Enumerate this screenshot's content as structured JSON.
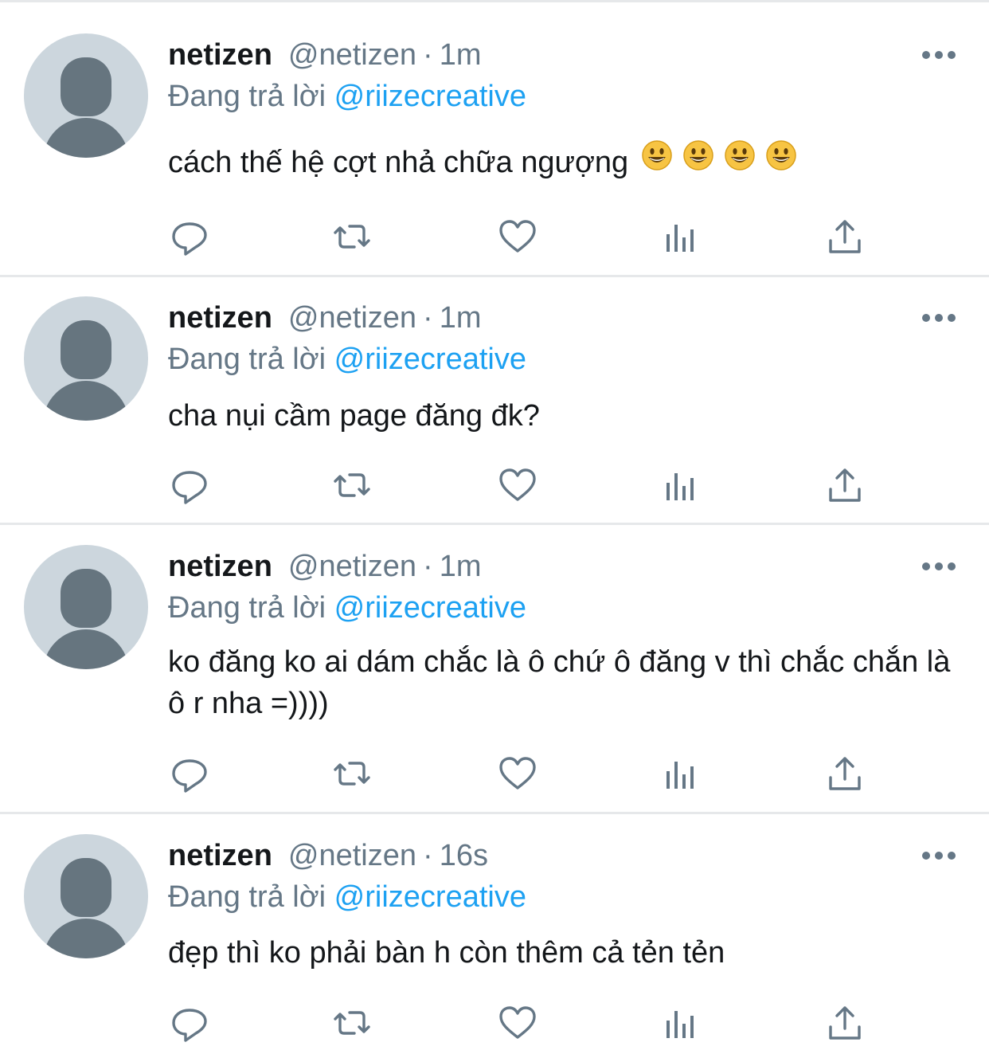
{
  "tweets": [
    {
      "name": "netizen",
      "handle": "@netizen",
      "separator": "·",
      "time": "1m",
      "reply_prefix": "Đang trả lời",
      "reply_to": "@riizecreative",
      "text": "cách thế hệ cợt nhả chữa ngượng",
      "emojis": [
        "grinning-face",
        "grinning-face",
        "grinning-face",
        "grinning-face"
      ]
    },
    {
      "name": "netizen",
      "handle": "@netizen",
      "separator": "·",
      "time": "1m",
      "reply_prefix": "Đang trả lời",
      "reply_to": "@riizecreative",
      "text": "cha nụi cầm page đăng đk?"
    },
    {
      "name": "netizen",
      "handle": "@netizen",
      "separator": "·",
      "time": "1m",
      "reply_prefix": "Đang trả lời",
      "reply_to": "@riizecreative",
      "text": "ko đăng ko ai dám chắc là ô chứ ô đăng v thì chắc chắn là ô r nha =))))"
    },
    {
      "name": "netizen",
      "handle": "@netizen",
      "separator": "·",
      "time": "16s",
      "reply_prefix": "Đang trả lời",
      "reply_to": "@riizecreative",
      "text": "đẹp thì ko phải bàn h còn thêm cả tẻn tẻn"
    }
  ],
  "icons": {
    "reply": "reply-icon",
    "retweet": "retweet-icon",
    "like": "heart-icon",
    "analytics": "analytics-icon",
    "share": "share-icon",
    "more": "more-icon"
  },
  "colors": {
    "text": "#14171a",
    "secondary": "#657786",
    "link": "#1da1f2",
    "divider": "#e6e8ea",
    "avatar_bg": "#ccd6dd",
    "avatar_fg": "#66757f"
  }
}
